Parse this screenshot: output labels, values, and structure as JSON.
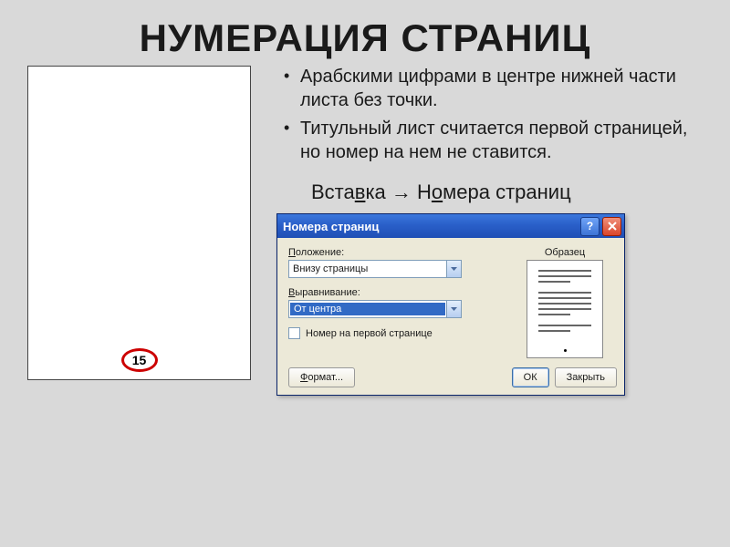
{
  "title": "НУМЕРАЦИЯ СТРАНИЦ",
  "page_example_number": "15",
  "bullets": [
    "Арабскими цифрами в центре нижней части листа без точки.",
    "Титульный лист считается первой страницей, но номер на нем не ставится."
  ],
  "menu_path": {
    "insert_prefix": "Вста",
    "insert_u": "в",
    "insert_suffix": "ка",
    "arrow": " → ",
    "num_prefix": "Н",
    "num_u": "о",
    "num_suffix": "мера страниц"
  },
  "dialog": {
    "title": "Номера страниц",
    "position_label": {
      "u": "П",
      "rest": "оложение:"
    },
    "position_value": "Внизу страницы",
    "align_label": {
      "u": "В",
      "rest": "ыравнивание:"
    },
    "align_value": "От центра",
    "checkbox_label": {
      "u": "Н",
      "rest": "омер на первой странице"
    },
    "preview_label": "Образец",
    "buttons": {
      "format": {
        "u": "Ф",
        "rest": "ормат..."
      },
      "ok": "ОК",
      "close": "Закрыть"
    }
  }
}
